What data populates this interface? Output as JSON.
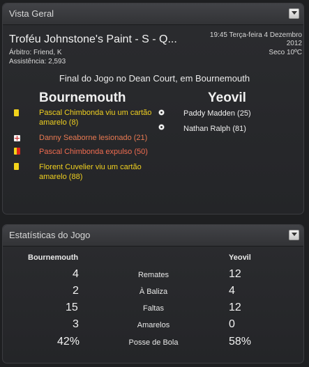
{
  "overview": {
    "title": "Vista Geral",
    "competition": "Troféu Johnstone's Paint - S - Q...",
    "referee": "Árbitro: Friend, K",
    "attendance": "Assistência: 2,593",
    "datetime_line1": "19:45 Terça-feira 4 Dezembro",
    "datetime_line2": "2012",
    "weather": "Seco 10ºC",
    "venue": "Final do Jogo no Dean Court, em Bournemouth",
    "home_team": "Bournemouth",
    "away_team": "Yeovil",
    "home_events": [
      {
        "type": "yellow-card",
        "text": "Pascal Chimbonda viu um cartão amarelo (8)"
      },
      {
        "type": "injury",
        "text": "Danny Seaborne lesionado (21)"
      },
      {
        "type": "red-card",
        "text": "Pascal Chimbonda expulso (50)"
      },
      {
        "type": "yellow-card",
        "text": "Florent Cuvelier viu um cartão amarelo (88)"
      }
    ],
    "away_goals": [
      {
        "type": "goal",
        "text": "Paddy Madden (25)"
      },
      {
        "type": "goal",
        "text": "Nathan Ralph (81)"
      }
    ]
  },
  "stats": {
    "title": "Estatísticas do Jogo",
    "home_header": "Bournemouth",
    "away_header": "Yeovil",
    "rows": [
      {
        "label": "Remates",
        "home": "4",
        "away": "12"
      },
      {
        "label": "À Baliza",
        "home": "2",
        "away": "4"
      },
      {
        "label": "Faltas",
        "home": "15",
        "away": "12"
      },
      {
        "label": "Amarelos",
        "home": "3",
        "away": "0"
      },
      {
        "label": "Posse de Bola",
        "home": "42%",
        "away": "58%"
      }
    ]
  }
}
